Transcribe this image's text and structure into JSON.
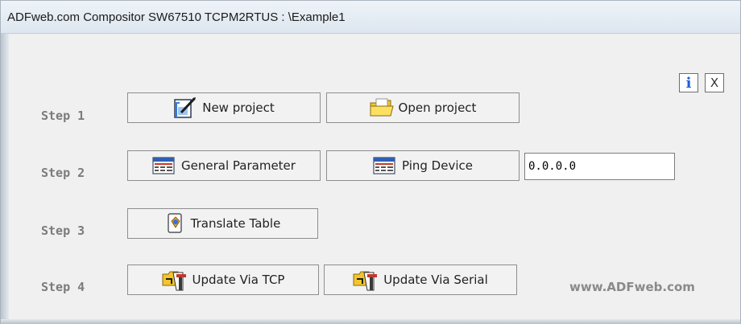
{
  "window": {
    "title": "ADFweb.com Compositor SW67510 TCPM2RTUS : \\Example1"
  },
  "top_buttons": {
    "info_label": "i",
    "close_label": "X"
  },
  "steps": [
    {
      "label": "Step 1"
    },
    {
      "label": "Step 2"
    },
    {
      "label": "Step 3"
    },
    {
      "label": "Step 4"
    }
  ],
  "buttons": {
    "new_project": "New project",
    "open_project": "Open project",
    "general_parameter": "General Parameter",
    "ping_device": "Ping Device",
    "translate_table": "Translate Table",
    "update_tcp": "Update Via TCP",
    "update_serial": "Update Via Serial"
  },
  "ping": {
    "ip_value": "0.0.0.0"
  },
  "footer": {
    "website": "www.ADFweb.com"
  },
  "icons": {
    "new_project": "new-project-icon",
    "open_project": "folder-open-icon",
    "general_parameter": "table-window-icon",
    "ping_device": "table-window-icon",
    "translate_table": "translate-table-icon",
    "update_tcp": "update-device-icon",
    "update_serial": "update-device-icon"
  },
  "colors": {
    "info_blue": "#1f5fd8",
    "step_gray": "#7b7b7b",
    "folder_yellow": "#f6d23c"
  }
}
